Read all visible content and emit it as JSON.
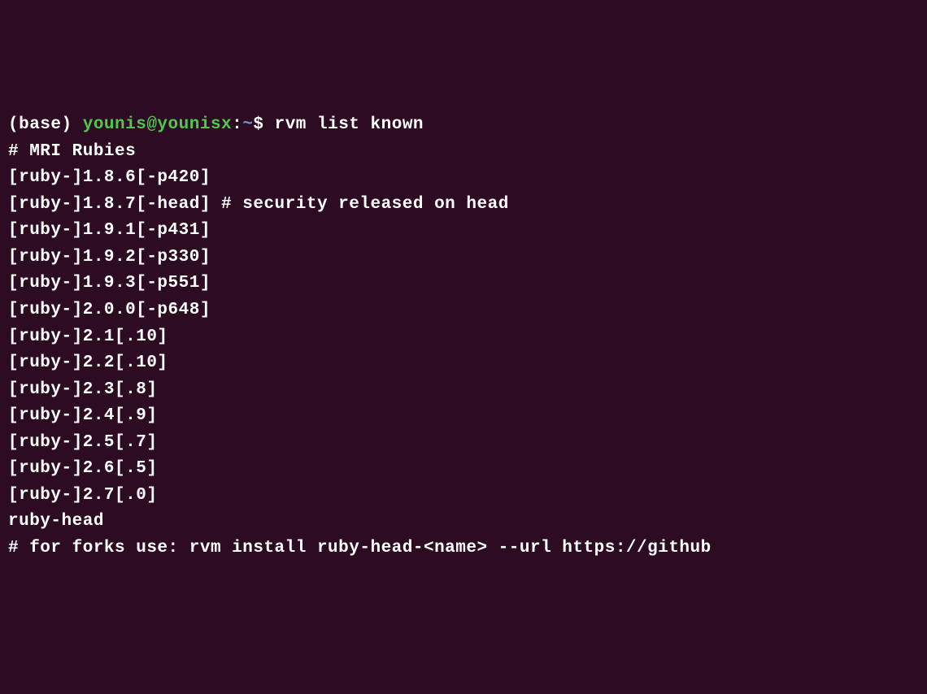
{
  "prompt": {
    "base": "(base) ",
    "user_host": "younis@younisx",
    "colon": ":",
    "path": "~",
    "dollar": "$ ",
    "command": "rvm list known"
  },
  "output": {
    "header": "# MRI Rubies",
    "lines": [
      "[ruby-]1.8.6[-p420]",
      "[ruby-]1.8.7[-head] # security released on head",
      "[ruby-]1.9.1[-p431]",
      "[ruby-]1.9.2[-p330]",
      "[ruby-]1.9.3[-p551]",
      "[ruby-]2.0.0[-p648]",
      "[ruby-]2.1[.10]",
      "[ruby-]2.2[.10]",
      "[ruby-]2.3[.8]",
      "[ruby-]2.4[.9]",
      "[ruby-]2.5[.7]",
      "[ruby-]2.6[.5]",
      "[ruby-]2.7[.0]",
      "ruby-head",
      "",
      "# for forks use: rvm install ruby-head-<name> --url https://github"
    ]
  }
}
